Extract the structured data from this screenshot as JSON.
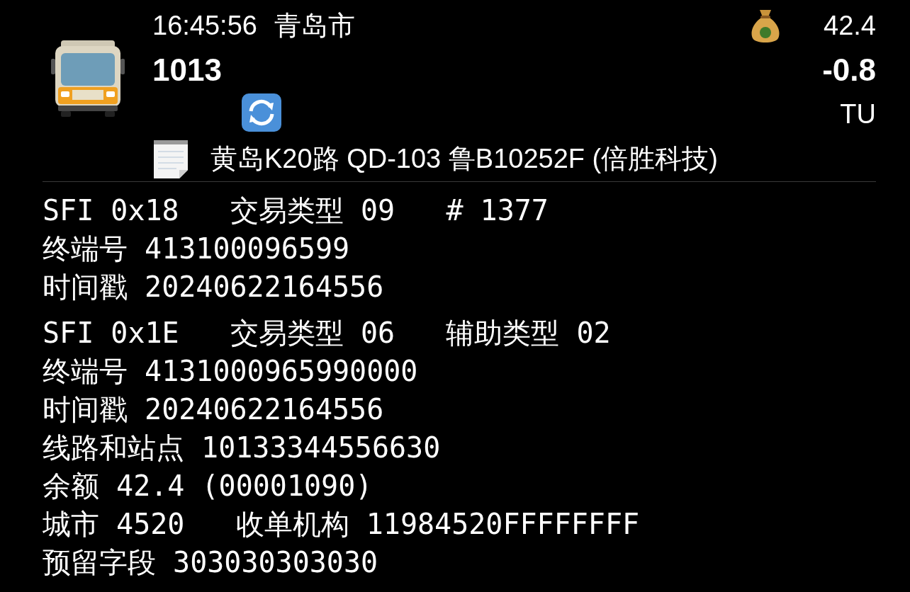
{
  "header": {
    "time": "16:45:56",
    "city": "青岛市",
    "balance": "42.4",
    "card_number": "1013",
    "amount": "-0.8",
    "card_type": "TU",
    "route": "黄岛K20路 QD-103 鲁B10252F (倍胜科技)"
  },
  "records": [
    {
      "lines": [
        "SFI 0x18   交易类型 09   # 1377",
        "终端号 413100096599",
        "时间戳 20240622164556"
      ]
    },
    {
      "lines": [
        "SFI 0x1E   交易类型 06   辅助类型 02",
        "终端号 4131000965990000",
        "时间戳 20240622164556",
        "线路和站点 10133344556630",
        "余额 42.4 (00001090)",
        "城市 4520   收单机构 11984520FFFFFFFF",
        "预留字段 303030303030"
      ]
    }
  ]
}
